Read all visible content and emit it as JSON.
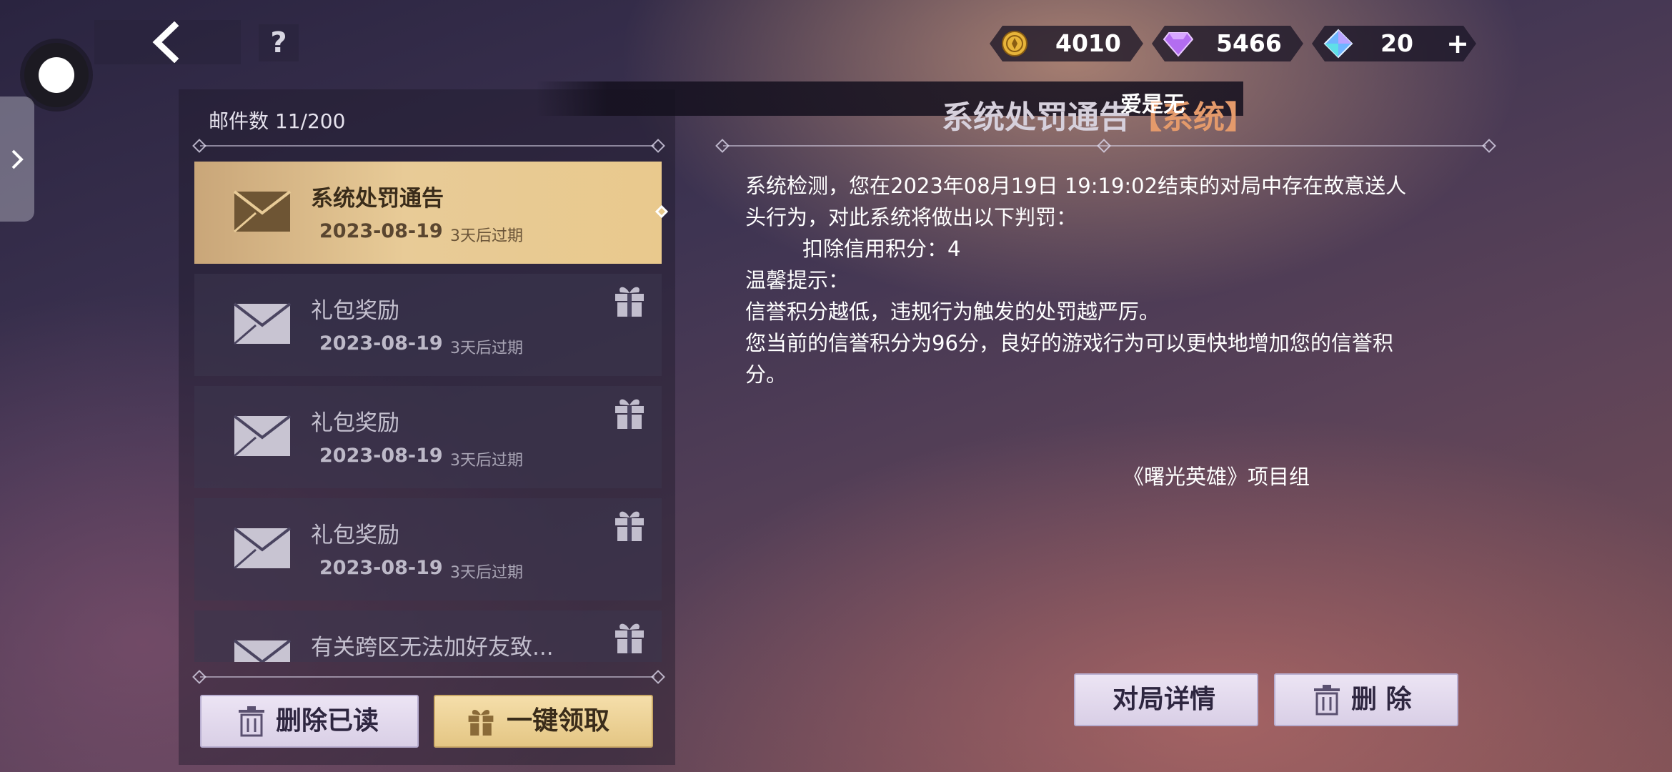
{
  "currency": {
    "coin": "4010",
    "purple_gem": "5466",
    "blue_gem": "20",
    "add_label": "+"
  },
  "nav": {
    "help_label": "?"
  },
  "mailbox": {
    "count_label": "邮件数 11/200",
    "items": [
      {
        "title": "系统处罚通告",
        "date": "2023-08-19",
        "expire": "3天后过期",
        "selected": true,
        "has_gift": false
      },
      {
        "title": "礼包奖励",
        "date": "2023-08-19",
        "expire": "3天后过期",
        "selected": false,
        "has_gift": true
      },
      {
        "title": "礼包奖励",
        "date": "2023-08-19",
        "expire": "3天后过期",
        "selected": false,
        "has_gift": true
      },
      {
        "title": "礼包奖励",
        "date": "2023-08-19",
        "expire": "3天后过期",
        "selected": false,
        "has_gift": true
      },
      {
        "title": "有关跨区无法加好友致...",
        "date": "",
        "expire": "",
        "selected": false,
        "has_gift": true
      }
    ],
    "delete_read_label": "删除已读",
    "claim_all_label": "一键领取"
  },
  "mail": {
    "heading": "系统处罚通告",
    "heading_tag": "【系统】",
    "sender": "爱是无",
    "body": [
      "系统检测，您在2023年08月19日 19:19:02结束的对局中存在故意送人",
      "头行为，对此系统将做出以下判罚：",
      "扣除信用积分：4",
      "温馨提示：",
      "信誉积分越低，违规行为触发的处罚越严厉。",
      "您当前的信誉积分为96分，良好的游戏行为可以更快地增加您的信誉积",
      "分。"
    ],
    "signature": "《曙光英雄》项目组",
    "match_details_label": "对局详情",
    "delete_label": "删 除"
  },
  "colors": {
    "selected_item": "#e8cb97",
    "accent_tag": "#e49a6b",
    "button_light": "#e4dcef",
    "button_gold": "#efd49c"
  }
}
